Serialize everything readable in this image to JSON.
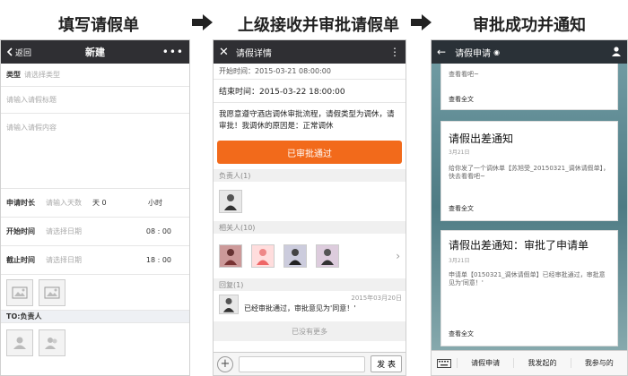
{
  "stages": {
    "s1": "填写请假单",
    "s2": "上级接收并审批请假单",
    "s3": "审批成功并通知"
  },
  "phone1": {
    "back_label": "返回",
    "title": "新建",
    "more_icon": "more-dots-icon",
    "type_label": "类型",
    "type_placeholder": "请选择类型",
    "title_placeholder": "请输入请假标题",
    "content_placeholder": "请输入请假内容",
    "duration_label": "申请时长",
    "duration_placeholder": "请输入天数",
    "days_value": "天 0",
    "hours_label": "小时",
    "start_label": "开始时间",
    "start_placeholder": "请选择日期",
    "start_time": "08 : 00",
    "end_label": "截止时间",
    "end_placeholder": "请选择日期",
    "end_time": "18 : 00",
    "to_label": "TO:负责人"
  },
  "phone2": {
    "title": "请假详情",
    "start_text": "开始时间：2015-03-21 08:00:00",
    "end_text": "结束时间：2015-03-22 18:00:00",
    "body": "我愿意遵守酒店调休审批流程，请假类型为调休，请审批！我调休的原因是：正常调休",
    "approved_button": "已审批通过",
    "manager_label": "负责人(1)",
    "related_label": "相关人(10)",
    "reply_label": "回复(1)",
    "reply_date": "2015年03月20日",
    "reply_text": "已经审批通过，审批意见为'同意！'",
    "no_more": "已没有更多",
    "send_button": "发 表"
  },
  "phone3": {
    "title": "请假申请",
    "card1_text": "查看看吧~",
    "read_more": "查看全文",
    "card2_title": "请假出差通知",
    "card2_date": "3月21日",
    "card2_body": "给你发了一个调休单【苏旭受_20150321_调休请假单】，快去看看吧~",
    "card3_title": "请假出差通知：审批了申请单",
    "card3_date": "3月21日",
    "card3_body": "申请单【0150321_调休请假单】已经审批通过，审批意见为'同意！'",
    "tab1": "请假申请",
    "tab2": "我发起的",
    "tab3": "我参与的"
  }
}
